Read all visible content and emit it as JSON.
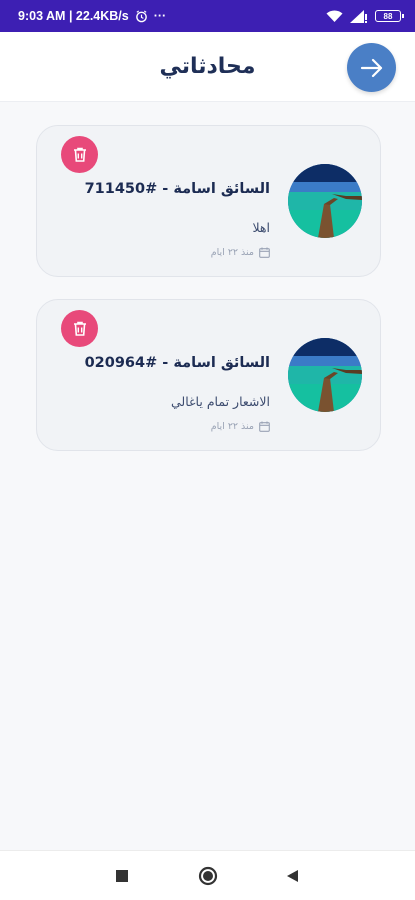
{
  "status_bar": {
    "time_speed": "9:03 AM | 22.4KB/s",
    "more_indicator": "···",
    "battery_level": "88"
  },
  "header": {
    "title": "محادثاتي",
    "back_icon": "arrow-right-icon"
  },
  "chats": [
    {
      "name": "السائق اسامة - #711450",
      "last_message": "اهلا",
      "time": "منذ ٢٢ ايام",
      "delete_icon": "trash-icon"
    },
    {
      "name": "السائق اسامة - #020964",
      "last_message": "الاشعار تمام ياغالي",
      "time": "منذ ٢٢ ايام",
      "delete_icon": "trash-icon"
    }
  ],
  "colors": {
    "status_bar": "#3d1fb3",
    "back_button": "#4a7fc6",
    "delete_button": "#e8497a",
    "title": "#1f2f57"
  },
  "nav_bar": {
    "icons": [
      "recents-square-icon",
      "home-circle-icon",
      "back-triangle-icon"
    ]
  }
}
